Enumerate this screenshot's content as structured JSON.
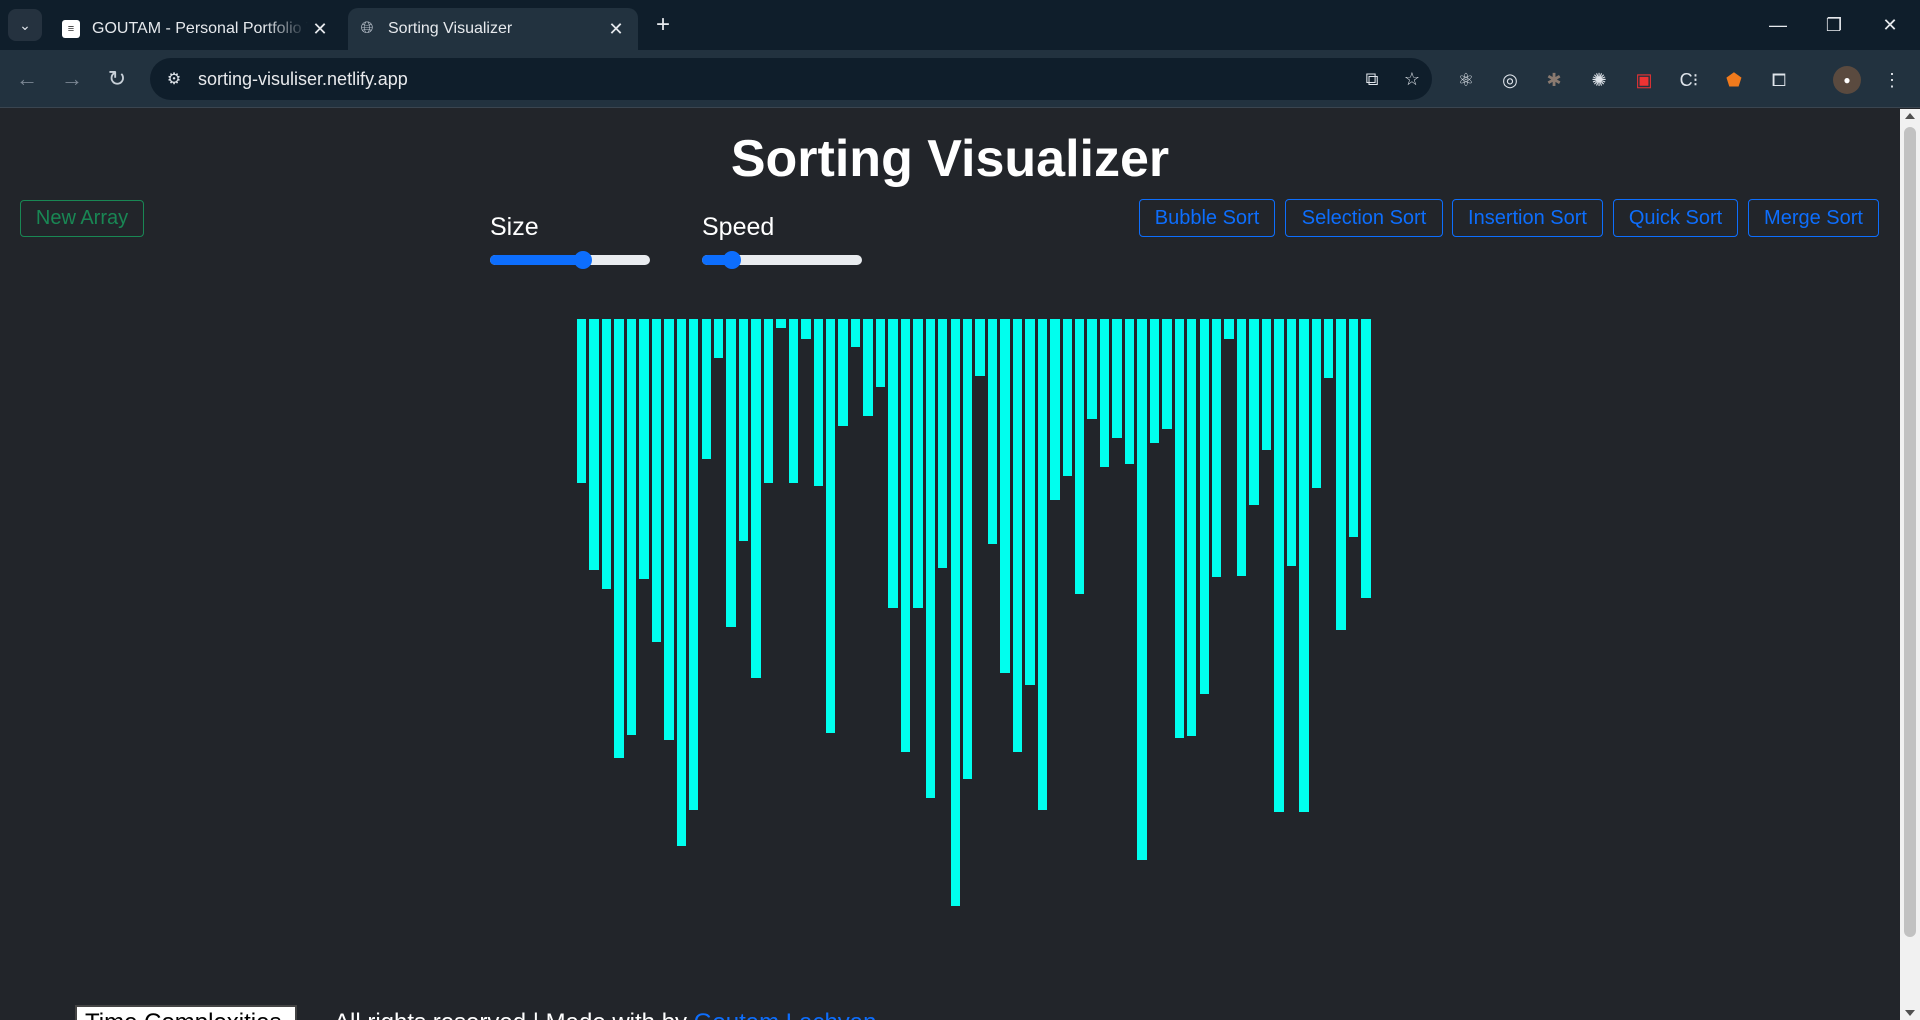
{
  "browser": {
    "tabs": [
      {
        "title": "GOUTAM - Personal Portfolio Template",
        "favicon": "portfolio-favicon-icon"
      },
      {
        "title": "Sorting Visualizer",
        "favicon": "globe-icon"
      }
    ],
    "url": "sorting-visuliser.netlify.app"
  },
  "page": {
    "title": "Sorting Visualizer",
    "new_array_label": "New Array",
    "size_label": "Size",
    "speed_label": "Speed",
    "size_value": 0.58,
    "speed_value": 0.19,
    "sort_buttons": [
      "Bubble Sort",
      "Selection Sort",
      "Insertion Sort",
      "Quick Sort",
      "Merge Sort"
    ]
  },
  "colors": {
    "bar": "#00ffee",
    "background": "#22252a",
    "primary": "#0d6efd",
    "success": "#198754"
  },
  "array": [
    172,
    262,
    282,
    458,
    434,
    272,
    338,
    440,
    550,
    512,
    147,
    42,
    322,
    232,
    375,
    172,
    10,
    172,
    22,
    175,
    432,
    112,
    30,
    102,
    72,
    302,
    452,
    302,
    500,
    260,
    612,
    480,
    60,
    235,
    370,
    452,
    382,
    512,
    190,
    165,
    287,
    105,
    155,
    125,
    152,
    565,
    130,
    116,
    438,
    435,
    392,
    270,
    22,
    269,
    195,
    138,
    515,
    258,
    515,
    177,
    63,
    325,
    228,
    292
  ],
  "footer": {
    "boxed_text": "Time Complexities",
    "text": "All rights reserved | Made with by ",
    "link_text": "Goutam Lachyan"
  }
}
